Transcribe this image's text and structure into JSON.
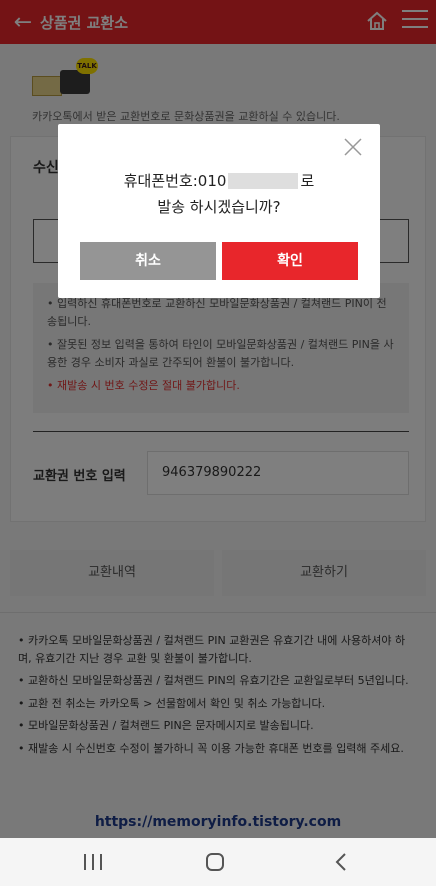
{
  "header": {
    "title": "상품권 교환소",
    "back_icon": "arrow-left-icon",
    "home_icon": "home-icon",
    "menu_icon": "hamburger-icon",
    "color": "#e8262b"
  },
  "intro": {
    "text": "카카오톡에서 받은 교환번호로 문화상품권을 교환하실 수 있습니다."
  },
  "form": {
    "recipient_label": "수신",
    "notices": [
      "• 입력하신 휴대폰번호로 교환하신 모바일문화상품권 / 컬쳐랜드 PIN이 전송됩니다.",
      "• 잘못된 정보 입력을 통하여 타인이 모바일문화상품권 / 컬쳐랜드 PIN을 사용한 경우 소비자 과실로 간주되어 환불이 불가합니다.",
      "• 재발송 시 번호 수정은 절대 불가합니다."
    ],
    "code_label": "교환권 번호 입력",
    "code_value": "946379890222"
  },
  "tabs": {
    "history": "교환내역",
    "exchange": "교환하기"
  },
  "bottom_notes": [
    "• 카카오톡 모바일문화상품권 / 컬쳐랜드 PIN 교환권은 유효기간 내에 사용하셔야 하며, 유효기간 지난 경우 교환 및 환불이 불가합니다.",
    "• 교환하신 모바일문화상품권 / 컬쳐랜드 PIN의 유효기간은 교환일로부터 5년입니다.",
    "• 교환 전 취소는 카카오톡 > 선물함에서 확인 및 취소 가능합니다.",
    "• 모바일문화상품권 / 컬쳐랜드 PIN은 문자메시지로 발송됩니다.",
    "• 재발송 시 수신번호 수정이 불가하니 꼭 이용 가능한 휴대폰 번호를 입력해 주세요."
  ],
  "watermark": "https://memoryinfo.tistory.com",
  "dialog": {
    "line1_prefix": "휴대폰번호:010",
    "line1_suffix": "로",
    "line2": "발송 하시겠습니까?",
    "cancel_label": "취소",
    "confirm_label": "확인",
    "close_icon": "close-icon"
  },
  "navbar": {
    "recent_icon": "recent-apps-icon",
    "home_icon": "home-circle-icon",
    "back_icon": "back-chevron-icon"
  }
}
